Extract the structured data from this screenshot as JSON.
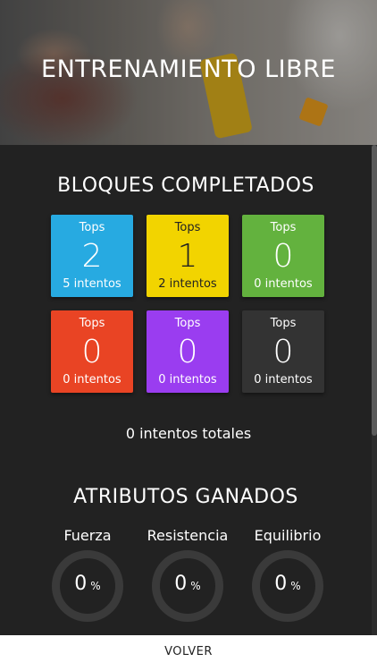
{
  "header": {
    "title": "ENTRENAMIENTO LIBRE"
  },
  "blocks": {
    "title": "BLOQUES COMPLETADOS",
    "tiles": [
      {
        "label": "Tops",
        "tops": "2",
        "attempts": "5 intentos",
        "color": "#27aae1"
      },
      {
        "label": "Tops",
        "tops": "1",
        "attempts": "2 intentos",
        "color": "#f2d400"
      },
      {
        "label": "Tops",
        "tops": "0",
        "attempts": "0 intentos",
        "color": "#63b23e"
      },
      {
        "label": "Tops",
        "tops": "0",
        "attempts": "0 intentos",
        "color": "#e94424"
      },
      {
        "label": "Tops",
        "tops": "0",
        "attempts": "0 intentos",
        "color": "#9a3df0"
      },
      {
        "label": "Tops",
        "tops": "0",
        "attempts": "0 intentos",
        "color": "#333333"
      }
    ],
    "total": "0 intentos totales"
  },
  "attributes": {
    "title": "ATRIBUTOS GANADOS",
    "items": [
      {
        "name": "Fuerza",
        "value": "0",
        "unit": "%"
      },
      {
        "name": "Resistencia",
        "value": "0",
        "unit": "%"
      },
      {
        "name": "Equilibrio",
        "value": "0",
        "unit": "%"
      }
    ]
  },
  "footer": {
    "back_label": "VOLVER"
  }
}
